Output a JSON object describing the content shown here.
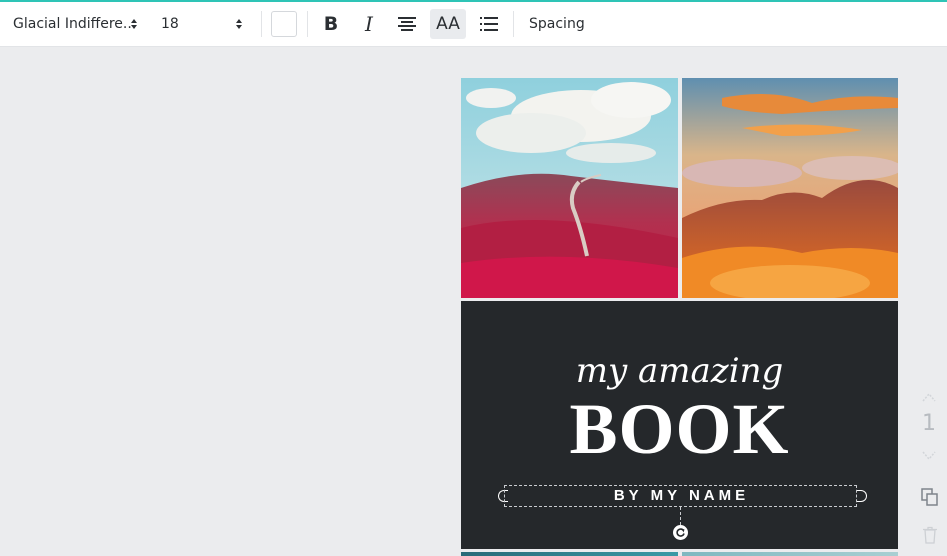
{
  "toolbar": {
    "font_family": "Glacial Indiffere...",
    "font_size": "18",
    "text_color": "#ffffff",
    "bold_icon": "bold-icon",
    "italic_icon": "italic-icon",
    "align_icon": "align-center-icon",
    "case_label": "AA",
    "list_icon": "list-icon",
    "spacing_label": "Spacing"
  },
  "cover": {
    "subtitle": "my amazing",
    "title": "BOOK",
    "byline": "BY MY NAME",
    "background": "#25282b"
  },
  "sidebar": {
    "page_number": "1",
    "icons": [
      "page-up-icon",
      "page-down-icon",
      "duplicate-page-icon",
      "delete-page-icon"
    ]
  },
  "accent_color": "#2ec4b6"
}
